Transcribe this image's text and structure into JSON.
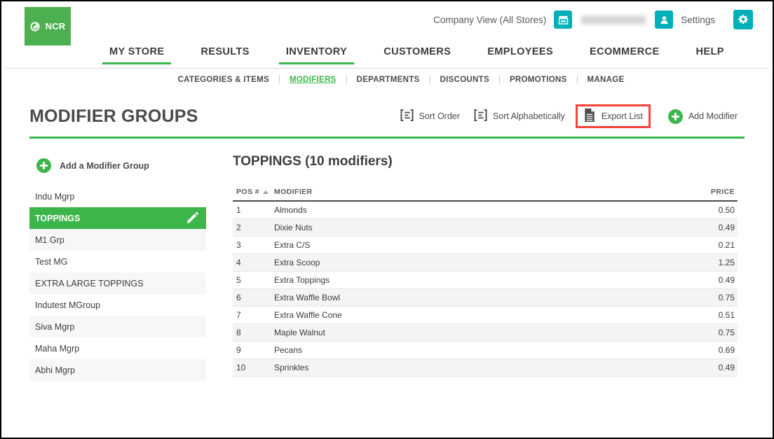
{
  "header": {
    "logo_text": "NCR",
    "company_view_label": "Company View (All Stores)",
    "user_name": "",
    "settings_label": "Settings"
  },
  "main_nav": [
    {
      "label": "MY STORE",
      "active": false
    },
    {
      "label": "RESULTS",
      "active": false
    },
    {
      "label": "INVENTORY",
      "active": true
    },
    {
      "label": "CUSTOMERS",
      "active": false
    },
    {
      "label": "EMPLOYEES",
      "active": false
    },
    {
      "label": "ECOMMERCE",
      "active": false
    },
    {
      "label": "HELP",
      "active": false
    }
  ],
  "sub_nav": [
    {
      "label": "CATEGORIES & ITEMS",
      "active": false
    },
    {
      "label": "MODIFIERS",
      "active": true
    },
    {
      "label": "DEPARTMENTS",
      "active": false
    },
    {
      "label": "DISCOUNTS",
      "active": false
    },
    {
      "label": "PROMOTIONS",
      "active": false
    },
    {
      "label": "MANAGE",
      "active": false
    }
  ],
  "page": {
    "title": "MODIFIER GROUPS"
  },
  "toolbar": {
    "sort_order_label": "Sort Order",
    "sort_alpha_label": "Sort Alphabetically",
    "export_list_label": "Export List",
    "add_modifier_label": "Add Modifier",
    "highlight_color": "#f9423a"
  },
  "sidebar": {
    "add_group_label": "Add a Modifier Group",
    "groups": [
      {
        "label": "Indu Mgrp",
        "active": false
      },
      {
        "label": "TOPPINGS",
        "active": true
      },
      {
        "label": "M1 Grp",
        "active": false
      },
      {
        "label": "Test MG",
        "active": false
      },
      {
        "label": "EXTRA LARGE TOPPINGS",
        "active": false
      },
      {
        "label": "Indutest MGroup",
        "active": false
      },
      {
        "label": "Siva Mgrp",
        "active": false
      },
      {
        "label": "Maha Mgrp",
        "active": false
      },
      {
        "label": "Abhi Mgrp",
        "active": false
      }
    ]
  },
  "main": {
    "panel_title": "TOPPINGS (10 modifiers)",
    "columns": [
      "POS #",
      "MODIFIER",
      "PRICE"
    ],
    "rows": [
      {
        "pos": "1",
        "modifier": "Almonds",
        "price": "0.50"
      },
      {
        "pos": "2",
        "modifier": "Dixie Nuts",
        "price": "0.49"
      },
      {
        "pos": "3",
        "modifier": "Extra C/S",
        "price": "0.21"
      },
      {
        "pos": "4",
        "modifier": "Extra Scoop",
        "price": "1.25"
      },
      {
        "pos": "5",
        "modifier": "Extra Toppings",
        "price": "0.49"
      },
      {
        "pos": "6",
        "modifier": "Extra Waffle Bowl",
        "price": "0.75"
      },
      {
        "pos": "7",
        "modifier": "Extra Waffle Cone",
        "price": "0.51"
      },
      {
        "pos": "8",
        "modifier": "Maple Walnut",
        "price": "0.75"
      },
      {
        "pos": "9",
        "modifier": "Pecans",
        "price": "0.69"
      },
      {
        "pos": "10",
        "modifier": "Sprinkles",
        "price": "0.49"
      }
    ]
  },
  "colors": {
    "brand_green": "#3cb54a",
    "logo_green": "#4caf50",
    "teal": "#00b0b9",
    "highlight_red": "#f9423a"
  }
}
